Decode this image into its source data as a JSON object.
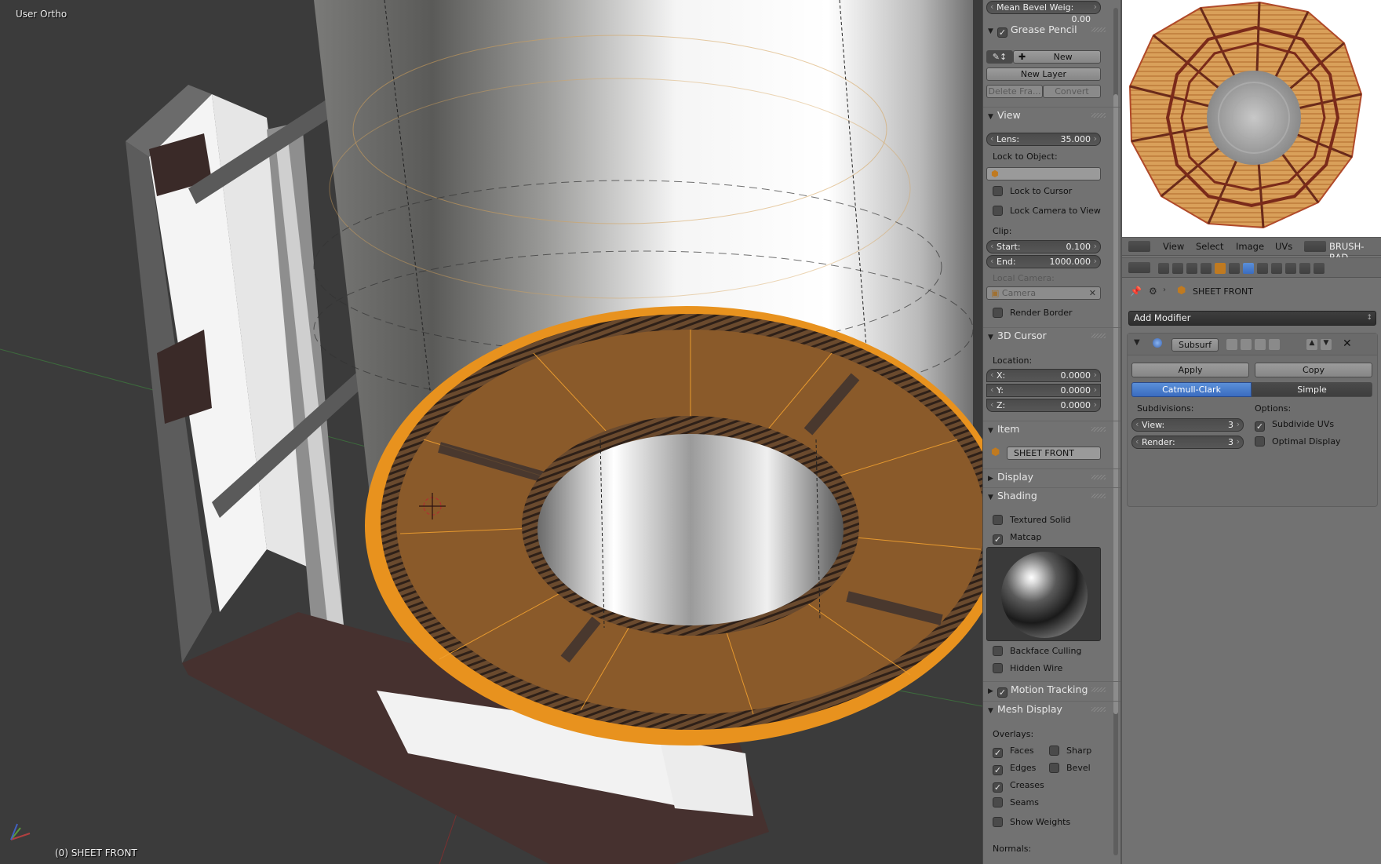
{
  "viewport": {
    "view_label": "User Ortho",
    "status_label": "(0) SHEET FRONT"
  },
  "npanel": {
    "mean_bevel": {
      "label": "Mean Bevel Weig:",
      "value": "0.00"
    },
    "grease_pencil": {
      "title": "Grease Pencil",
      "enabled": true,
      "new_label": "New",
      "new_layer_label": "New Layer",
      "delete_frame_label": "Delete Fra...",
      "convert_label": "Convert"
    },
    "view": {
      "title": "View",
      "lens": {
        "label": "Lens:",
        "value": "35.000"
      },
      "lock_to_object_label": "Lock to Object:",
      "lock_to_cursor": "Lock to Cursor",
      "lock_camera_to_view": "Lock Camera to View",
      "clip_label": "Clip:",
      "clip_start": {
        "label": "Start:",
        "value": "0.100"
      },
      "clip_end": {
        "label": "End:",
        "value": "1000.000"
      },
      "local_camera_label": "Local Camera:",
      "camera_value": "Camera",
      "render_border": "Render Border"
    },
    "cursor3d": {
      "title": "3D Cursor",
      "location_label": "Location:",
      "x": {
        "label": "X:",
        "value": "0.0000"
      },
      "y": {
        "label": "Y:",
        "value": "0.0000"
      },
      "z": {
        "label": "Z:",
        "value": "0.0000"
      }
    },
    "item": {
      "title": "Item",
      "name": "SHEET FRONT"
    },
    "display": {
      "title": "Display"
    },
    "shading": {
      "title": "Shading",
      "textured_solid": "Textured Solid",
      "matcap": "Matcap",
      "matcap_checked": true,
      "backface_culling": "Backface Culling",
      "hidden_wire": "Hidden Wire"
    },
    "motion_tracking": {
      "title": "Motion Tracking",
      "enabled": true
    },
    "mesh_display": {
      "title": "Mesh Display",
      "overlays_label": "Overlays:",
      "faces": "Faces",
      "sharp": "Sharp",
      "edges": "Edges",
      "bevel": "Bevel",
      "creases": "Creases",
      "seams": "Seams",
      "show_weights": "Show Weights",
      "normals_label": "Normals:"
    }
  },
  "uv_header": {
    "menus": [
      "View",
      "Select",
      "Image",
      "UVs"
    ],
    "image_name": "BRUSH-RAD"
  },
  "properties": {
    "object_name": "SHEET FRONT",
    "add_modifier_label": "Add Modifier",
    "modifier": {
      "name": "Subsurf",
      "apply_label": "Apply",
      "copy_label": "Copy",
      "catmull_label": "Catmull-Clark",
      "simple_label": "Simple",
      "subdivisions_label": "Subdivisions:",
      "options_label": "Options:",
      "view": {
        "label": "View:",
        "value": "3"
      },
      "render": {
        "label": "Render:",
        "value": "3"
      },
      "subdivide_uvs": "Subdivide UVs",
      "subdivide_uvs_checked": true,
      "optimal_display": "Optimal Display"
    }
  },
  "colors": {
    "selection_orange": "#e8921e",
    "face_brown": "#8a5a2a",
    "panel_gray": "#727272",
    "active_blue": "#5680c2"
  }
}
